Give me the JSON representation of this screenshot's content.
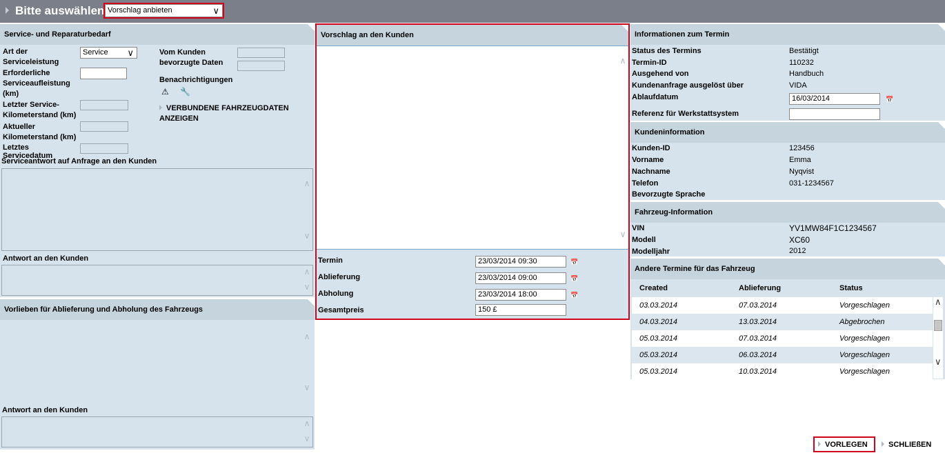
{
  "header": {
    "title": "Bitte auswählen",
    "action_select": "Vorschlag anbieten"
  },
  "service": {
    "title": "Service- und Reparaturbedarf",
    "art_label": "Art der Serviceleistung",
    "art_value": "Service",
    "erforderlich_label": "Erforderliche Serviceaufleistung (km)",
    "letzter_km_label": "Letzter Service-Kilometerstand (km)",
    "aktueller_km_label": "Aktueller Kilometerstand (km)",
    "letztes_datum_label": "Letztes Servicedatum",
    "bevorzugte_label": "Vom Kunden bevorzugte Daten",
    "benachrichtigungen_label": "Benachrichtigungen",
    "verbundene_link": "VERBUNDENE FAHRZEUGDATEN ANZEIGEN",
    "serviceantwort_label": "Serviceantwort auf Anfrage an den Kunden",
    "antwort_label": "Antwort an den Kunden"
  },
  "vorlieben": {
    "title": "Vorlieben für Ablieferung und Abholung des Fahrzeugs",
    "antwort_label": "Antwort an den Kunden"
  },
  "vorschlag": {
    "title": "Vorschlag an den Kunden",
    "termin_label": "Termin",
    "termin_value": "23/03/2014 09:30",
    "ablieferung_label": "Ablieferung",
    "ablieferung_value": "23/03/2014 09:00",
    "abholung_label": "Abholung",
    "abholung_value": "23/03/2014 18:00",
    "gesamtpreis_label": "Gesamtpreis",
    "gesamtpreis_value": "150 £"
  },
  "termin_info": {
    "title": "Informationen zum Termin",
    "rows": [
      {
        "label": "Status des Termins",
        "value": "Bestätigt"
      },
      {
        "label": "Termin-ID",
        "value": "110232"
      },
      {
        "label": "Ausgehend von",
        "value": "Handbuch"
      },
      {
        "label": "Kundenanfrage ausgelöst über",
        "value": "VIDA"
      }
    ],
    "ablaufdatum_label": "Ablaufdatum",
    "ablaufdatum_value": "16/03/2014",
    "referenz_label": "Referenz für Werkstattsystem"
  },
  "kunde": {
    "title": "Kundeninformation",
    "rows": [
      {
        "label": "Kunden-ID",
        "value": "123456"
      },
      {
        "label": "Vorname",
        "value": "Emma"
      },
      {
        "label": "Nachname",
        "value": "Nyqvist"
      },
      {
        "label": "Telefon",
        "value": "031-1234567"
      },
      {
        "label": "Bevorzugte Sprache",
        "value": ""
      }
    ]
  },
  "fahrzeug": {
    "title": "Fahrzeug-Information",
    "rows": [
      {
        "label": "VIN",
        "value": "YV1MW84F1C1234567"
      },
      {
        "label": "Modell",
        "value": "XC60"
      },
      {
        "label": "Modelljahr",
        "value": "2012"
      }
    ]
  },
  "andere": {
    "title": "Andere Termine für das Fahrzeug",
    "columns": [
      "Created",
      "Ablieferung",
      "Status"
    ],
    "rows": [
      [
        "03.03.2014",
        "07.03.2014",
        "Vorgeschlagen"
      ],
      [
        "04.03.2014",
        "13.03.2014",
        "Abgebrochen"
      ],
      [
        "05.03.2014",
        "07.03.2014",
        "Vorgeschlagen"
      ],
      [
        "05.03.2014",
        "06.03.2014",
        "Vorgeschlagen"
      ],
      [
        "05.03.2014",
        "10.03.2014",
        "Vorgeschlagen"
      ]
    ]
  },
  "footer": {
    "vorlegen": "VORLEGEN",
    "schliessen": "SCHLIEßEN"
  }
}
